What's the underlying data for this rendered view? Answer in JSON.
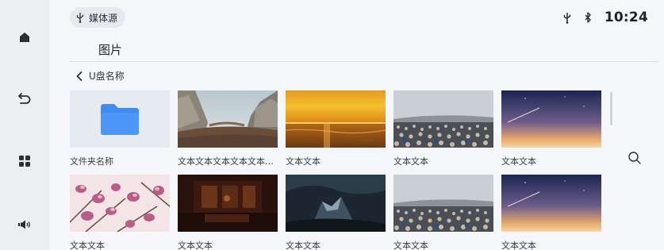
{
  "status_bar": {
    "source_label": "媒体源",
    "time": "10:24"
  },
  "sidebar": {
    "items": [
      {
        "icon": "home-icon"
      },
      {
        "icon": "back-icon"
      },
      {
        "icon": "apps-icon"
      },
      {
        "icon": "volume-icon"
      }
    ]
  },
  "page": {
    "title": "图片",
    "breadcrumb": "U盘名称"
  },
  "grid": {
    "row1": [
      {
        "caption": "文件夹名称",
        "kind": "folder"
      },
      {
        "caption": "文本文本文本文本文本文本",
        "kind": "valley"
      },
      {
        "caption": "文本文本",
        "kind": "sunset"
      },
      {
        "caption": "文本文本",
        "kind": "crowd"
      },
      {
        "caption": "文本文本",
        "kind": "sky"
      }
    ],
    "row2": [
      {
        "caption": "文本文本",
        "kind": "blossom"
      },
      {
        "caption": "文本文本",
        "kind": "room"
      },
      {
        "caption": "文本文本",
        "kind": "cave"
      },
      {
        "caption": "文本文本",
        "kind": "crowd"
      },
      {
        "caption": "文本文本",
        "kind": "sky"
      }
    ]
  },
  "colors": {
    "folder": "#3d8df5",
    "accent": "#1f2329"
  }
}
